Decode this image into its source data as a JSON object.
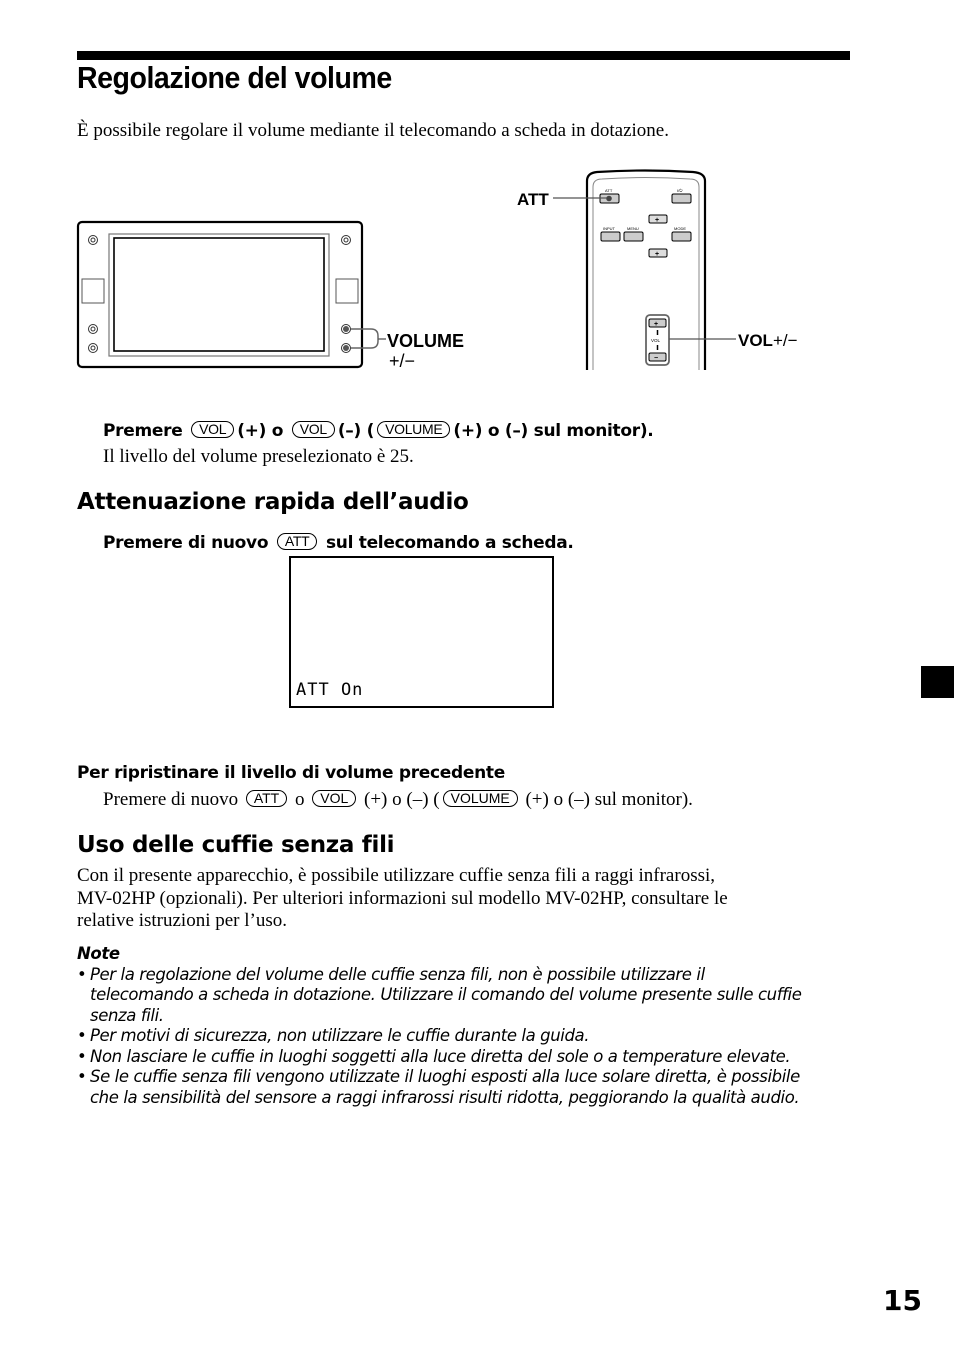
{
  "page": {
    "title": "Regolazione del volume",
    "intro": "È possibile regolare il volume mediante il telecomando a scheda in dotazione.",
    "page_number": "15"
  },
  "illustration": {
    "monitor_label": "VOLUME",
    "monitor_sublabel": "+/−",
    "remote_att_label": "ATT",
    "remote_vol_label": "VOL",
    "remote_vol_sublabel": "+/−",
    "remote_buttons": [
      "ATT",
      "I/⏻",
      "INPUT",
      "MENU",
      "MODE",
      "+",
      "+",
      "VOL +",
      "VOL",
      "VOL −"
    ]
  },
  "step1": {
    "prefix": "Premere",
    "key1": "VOL",
    "mid1": "(+) o",
    "key2": "VOL",
    "mid2": "(–) (",
    "key3": "VOLUME",
    "suffix": "(+) o (–) sul monitor).",
    "detail": "Il livello del volume preselezionato è 25."
  },
  "section_att": {
    "heading": "Attenuazione rapida dell’audio",
    "instr_prefix": "Premere di nuovo",
    "instr_key": "ATT",
    "instr_suffix": "sul telecomando a scheda.",
    "osd_text": "ATT On"
  },
  "section_restore": {
    "heading": "Per ripristinare il livello di volume precedente",
    "prefix": "Premere di nuovo",
    "key1": "ATT",
    "mid1": "o",
    "key2": "VOL",
    "mid2": "(+) o (–) (",
    "key3": "VOLUME",
    "suffix": "(+) o (–) sul monitor)."
  },
  "section_headphones": {
    "heading": "Uso delle cuffie senza fili",
    "lines": [
      "Con il presente apparecchio, è possibile utilizzare cuffie senza fili a raggi infrarossi,",
      "MV-02HP (opzionali). Per ulteriori informazioni sul modello MV-02HP, consultare le",
      "relative istruzioni per l’uso."
    ],
    "note_title": "Note",
    "notes": [
      "Per la regolazione del volume delle cuffie senza fili, non è possibile utilizzare il telecomando a scheda in dotazione. Utilizzare il comando del volume presente sulle cuffie senza fili.",
      "Per motivi di sicurezza, non utilizzare le cuffie durante la guida.",
      "Non lasciare le cuffie in luoghi soggetti alla luce diretta del sole o a temperature elevate.",
      "Se le cuffie senza fili vengono utilizzate il luoghi esposti alla luce solare diretta, è possibile che la sensibilità del sensore a raggi infrarossi risulti ridotta, peggiorando la qualità audio."
    ]
  }
}
